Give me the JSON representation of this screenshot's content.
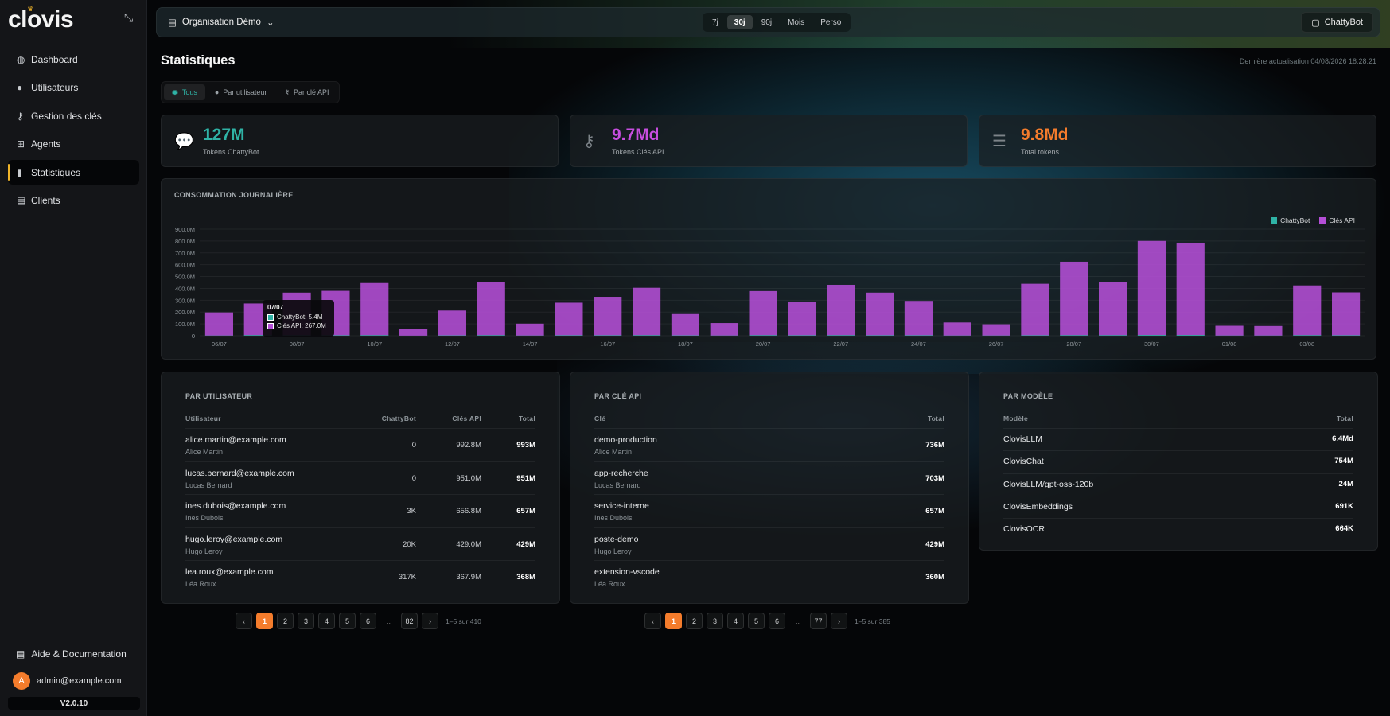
{
  "app": {
    "logo": "clovis",
    "version": "V2.0.10"
  },
  "sidebar": {
    "items": [
      {
        "label": "Dashboard",
        "icon": "dashboard-icon"
      },
      {
        "label": "Utilisateurs",
        "icon": "user-icon"
      },
      {
        "label": "Gestion des clés",
        "icon": "key-icon"
      },
      {
        "label": "Agents",
        "icon": "robot-icon"
      },
      {
        "label": "Statistiques",
        "icon": "bar-chart-icon",
        "active": true
      },
      {
        "label": "Clients",
        "icon": "building-icon"
      }
    ],
    "help": "Aide & Documentation",
    "user_initial": "A",
    "user_email": "admin@example.com"
  },
  "topbar": {
    "org": "Organisation Démo",
    "periods": [
      "7j",
      "30j",
      "90j",
      "Mois",
      "Perso"
    ],
    "active_period": "30j",
    "chatbot": "ChattyBot"
  },
  "page": {
    "title": "Statistiques",
    "last_update": "Dernière actualisation 04/08/2026 18:28:21",
    "tabs": [
      "Tous",
      "Par utilisateur",
      "Par clé API"
    ]
  },
  "kpis": [
    {
      "value": "127M",
      "label": "Tokens ChattyBot",
      "color": "#2fb3a6"
    },
    {
      "value": "9.7Md",
      "label": "Tokens Clés API",
      "color": "#c84ee0"
    },
    {
      "value": "9.8Md",
      "label": "Total tokens",
      "color": "#f47c2c"
    }
  ],
  "chart_title": "Consommation journalière",
  "chart_data": {
    "type": "bar",
    "stacked": true,
    "categories": [
      "06/07",
      "07/07",
      "08/07",
      "09/07",
      "10/07",
      "11/07",
      "12/07",
      "13/07",
      "14/07",
      "15/07",
      "16/07",
      "17/07",
      "18/07",
      "19/07",
      "20/07",
      "21/07",
      "22/07",
      "23/07",
      "24/07",
      "25/07",
      "26/07",
      "27/07",
      "28/07",
      "29/07",
      "30/07",
      "31/07",
      "01/08",
      "02/08",
      "03/08",
      "04/08"
    ],
    "tick_labels": [
      "06/07",
      "08/07",
      "10/07",
      "12/07",
      "14/07",
      "16/07",
      "18/07",
      "20/07",
      "22/07",
      "24/07",
      "26/07",
      "28/07",
      "30/07",
      "01/08",
      "03/08"
    ],
    "series": [
      {
        "name": "ChattyBot",
        "color": "#2fb3a6",
        "values": [
          2,
          5.4,
          4,
          4,
          5,
          1,
          3,
          5,
          2,
          4,
          4,
          5,
          3,
          2,
          5,
          4,
          5,
          4,
          4,
          2,
          2,
          4,
          5,
          5,
          6,
          6,
          2,
          2,
          5,
          4
        ]
      },
      {
        "name": "Clés API",
        "color": "#b44ed6",
        "values": [
          195,
          267,
          360,
          375,
          440,
          58,
          210,
          445,
          100,
          275,
          325,
          400,
          180,
          105,
          372,
          285,
          425,
          360,
          290,
          110,
          95,
          435,
          620,
          445,
          795,
          780,
          82,
          80,
          420,
          362
        ]
      }
    ],
    "yticks": [
      "0",
      "100.0M",
      "200.0M",
      "300.0M",
      "400.0M",
      "500.0M",
      "600.0M",
      "700.0M",
      "800.0M",
      "900.0M"
    ],
    "ylim": [
      0,
      900
    ],
    "grid": true,
    "legend_position": "top-right"
  },
  "tooltip": {
    "title": "07/07",
    "chattybot": "ChattyBot: 5.4M",
    "api": "Clés API: 267.0M"
  },
  "by_user": {
    "title": "Par utilisateur",
    "headers": [
      "Utilisateur",
      "ChattyBot",
      "Clés API",
      "Total"
    ],
    "rows": [
      {
        "email": "alice.martin@example.com",
        "name": "Alice Martin",
        "chattybot": "0",
        "api": "992.8M",
        "total": "993M"
      },
      {
        "email": "lucas.bernard@example.com",
        "name": "Lucas Bernard",
        "chattybot": "0",
        "api": "951.0M",
        "total": "951M"
      },
      {
        "email": "ines.dubois@example.com",
        "name": "Inès Dubois",
        "chattybot": "3K",
        "api": "656.8M",
        "total": "657M"
      },
      {
        "email": "hugo.leroy@example.com",
        "name": "Hugo Leroy",
        "chattybot": "20K",
        "api": "429.0M",
        "total": "429M"
      },
      {
        "email": "lea.roux@example.com",
        "name": "Léa Roux",
        "chattybot": "317K",
        "api": "367.9M",
        "total": "368M"
      }
    ],
    "pages": [
      "1",
      "2",
      "3",
      "4",
      "5",
      "6",
      "..",
      "82"
    ],
    "info": "1–5 sur 410"
  },
  "by_key": {
    "title": "Par clé API",
    "headers": [
      "Clé",
      "Total"
    ],
    "rows": [
      {
        "key": "demo-production",
        "owner": "Alice Martin",
        "total": "736M"
      },
      {
        "key": "app-recherche",
        "owner": "Lucas Bernard",
        "total": "703M"
      },
      {
        "key": "service-interne",
        "owner": "Inès Dubois",
        "total": "657M"
      },
      {
        "key": "poste-demo",
        "owner": "Hugo Leroy",
        "total": "429M"
      },
      {
        "key": "extension-vscode",
        "owner": "Léa Roux",
        "total": "360M"
      }
    ],
    "pages": [
      "1",
      "2",
      "3",
      "4",
      "5",
      "6",
      "..",
      "77"
    ],
    "info": "1–5 sur 385"
  },
  "by_model": {
    "title": "Par modèle",
    "headers": [
      "Modèle",
      "Total"
    ],
    "rows": [
      {
        "model": "ClovisLLM",
        "total": "6.4Md"
      },
      {
        "model": "ClovisChat",
        "total": "754M"
      },
      {
        "model": "ClovisLLM/gpt-oss-120b",
        "total": "24M"
      },
      {
        "model": "ClovisEmbeddings",
        "total": "691K"
      },
      {
        "model": "ClovisOCR",
        "total": "664K"
      }
    ]
  }
}
